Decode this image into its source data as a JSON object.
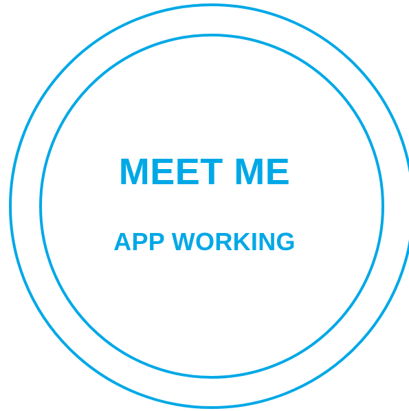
{
  "logo": {
    "title": "MEET ME",
    "subtitle": "APP WORKING"
  },
  "colors": {
    "accent": "#00a8e6",
    "background": "#ffffff"
  }
}
